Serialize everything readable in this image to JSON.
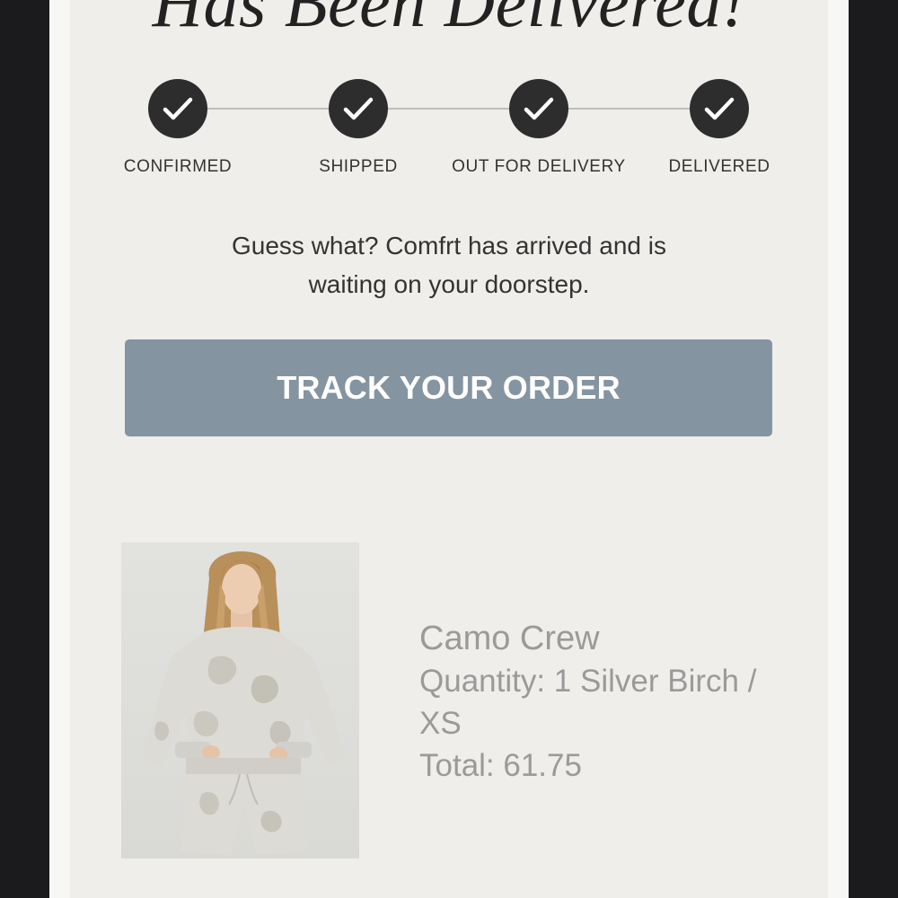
{
  "headline": "Has Been Delivered!",
  "steps": [
    {
      "label": "CONFIRMED",
      "icon": "check-icon"
    },
    {
      "label": "SHIPPED",
      "icon": "check-icon"
    },
    {
      "label": "OUT FOR DELIVERY",
      "icon": "check-icon"
    },
    {
      "label": "DELIVERED",
      "icon": "check-icon"
    }
  ],
  "message": {
    "line1": "Guess what? Comfrt has arrived and is",
    "line2": "waiting on your doorstep."
  },
  "cta": {
    "label": "TRACK YOUR ORDER",
    "color": "#8594a1"
  },
  "product": {
    "name": "Camo Crew",
    "quantity_line1": "Quantity: 1 Silver Birch /",
    "quantity_line2": "XS",
    "total": "Total: 61.75"
  },
  "colors": {
    "step_fill": "#2d2d2d",
    "email_background": "#efeeeb",
    "muted_text": "#9a9a9a"
  }
}
